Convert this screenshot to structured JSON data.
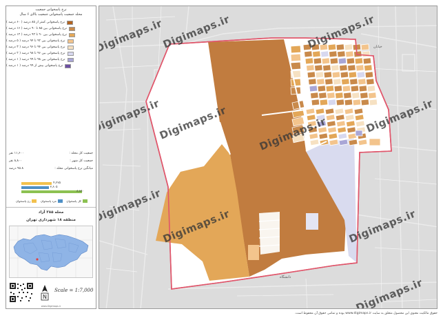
{
  "panel": {
    "title_line1": "نرخ پاسخوانی جمعیت",
    "title_line2": "محله جمعیت پاسخوانی جمعیت بالای ۶ سال",
    "legend": [
      {
        "label": "نرخ پاسخوانی کمتر از ۸۵ درصد ( ۶۰ درصد )",
        "color": "#b3631f"
      },
      {
        "label": "نرخ پاسخوانی بین ۸۵ تا ۹۰ درصد ( ۱۶ درصد )",
        "color": "#c98a4b"
      },
      {
        "label": "نرخ پاسخوانی بین ۹۰ تا ۹۲ درصد ( ۱۲ درصد )",
        "color": "#e3a758"
      },
      {
        "label": "نرخ پاسخوانی بین ۹۲ تا ۹۴ درصد ( ۵ درصد )",
        "color": "#f3c48c"
      },
      {
        "label": "نرخ پاسخوانی بین ۹۴ تا ۹۶ درصد ( ۳ درصد )",
        "color": "#f6e1c2"
      },
      {
        "label": "نرخ پاسخوانی بین ۹۶ تا ۹۸ درصد ( ۲ درصد )",
        "color": "#d7d8ef"
      },
      {
        "label": "نرخ پاسخوانی بین ۹۸ تا ۹۹ درصد ( ۱ درصد )",
        "color": "#a9a6d6"
      },
      {
        "label": "نرخ پاسخوانی بیش از ۹۹ درصد ( ۱ درصد )",
        "color": "#6d4fa3"
      }
    ],
    "stats": [
      {
        "label": "جمعیت کل محله :",
        "value": "۱۱,۶۰۰ نفر"
      },
      {
        "label": "جمعیت کل شهر :",
        "value": "۸,۸۰۰ نفر"
      },
      {
        "label": "میانگین نرخ پاسخوانی محله :",
        "value": "۹۵.۸ درصد"
      }
    ],
    "bars": [
      {
        "value_label": "۴,۲۷۵",
        "fraction": 0.49,
        "color": "#f2c14e"
      },
      {
        "value_label": "۳,۸۰۵",
        "fraction": 0.44,
        "color": "#4f90c6"
      },
      {
        "value_label": "۸,۸۸۰",
        "fraction": 0.98,
        "color": "#8cc152"
      }
    ],
    "density_legend": [
      {
        "label": "زن پاسخوان",
        "color": "#f2c14e"
      },
      {
        "label": "مرد پاسخوان",
        "color": "#4f90c6"
      },
      {
        "label": "کل پاسخوان",
        "color": "#8cc152"
      }
    ],
    "area_title": "محله ۳۸۵ آزاد",
    "area_subtitle": "منطقه ۱۸ شهرداری تهران",
    "scale": "Scale = 1:7,000",
    "north_letter": "N",
    "footer": "www.Digimaps.ir"
  },
  "map": {
    "background_color": "#dcdcdc",
    "boundary_color": "#e0566b",
    "watermarks": [
      "Digimaps.ir",
      "Digimaps.ir",
      "Digimaps.ir",
      "Digimaps.ir",
      "Digimaps.ir",
      "Digimaps.ir",
      "Digimaps.ir",
      "Digimaps.ir",
      "Digimaps.ir",
      "Digimaps.ir",
      "Digimaps.ir"
    ],
    "street_label_1": "دانشگاه",
    "street_label_2": "خیابان"
  },
  "footer_note": "حقوق مالکیت معنوی این محصول متعلق به سایت www.digimaps.ir بوده و تمامی حقوق آن محفوظ است."
}
